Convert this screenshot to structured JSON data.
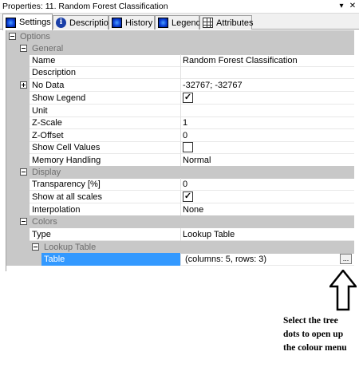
{
  "window": {
    "title": "Properties: 11. Random Forest Classification"
  },
  "tabs": [
    {
      "label": "Settings",
      "icon": "settings-icon"
    },
    {
      "label": "Description",
      "icon": "info-icon"
    },
    {
      "label": "History",
      "icon": "history-icon"
    },
    {
      "label": "Legend",
      "icon": "legend-icon"
    },
    {
      "label": "Attributes",
      "icon": "table-icon"
    }
  ],
  "grid": {
    "options": "Options",
    "general": "General",
    "name_label": "Name",
    "name_value": "Random Forest Classification",
    "description_label": "Description",
    "description_value": "",
    "nodata_label": "No Data",
    "nodata_value": "-32767; -32767",
    "show_legend_label": "Show Legend",
    "show_legend_value": true,
    "unit_label": "Unit",
    "unit_value": "",
    "zscale_label": "Z-Scale",
    "zscale_value": "1",
    "zoffset_label": "Z-Offset",
    "zoffset_value": "0",
    "show_cell_values_label": "Show Cell Values",
    "show_cell_values_value": false,
    "memory_label": "Memory Handling",
    "memory_value": "Normal",
    "display": "Display",
    "transparency_label": "Transparency [%]",
    "transparency_value": "0",
    "show_all_scales_label": "Show at all scales",
    "show_all_scales_value": true,
    "interpolation_label": "Interpolation",
    "interpolation_value": "None",
    "colors": "Colors",
    "type_label": "Type",
    "type_value": "Lookup Table",
    "lookup_table": "Lookup Table",
    "table_label": "Table",
    "table_value": "(columns: 5, rows: 3)",
    "ellipsis": "..."
  },
  "annotation": {
    "line1": "Select the tree",
    "line2": "dots to open up",
    "line3": "the colour menu"
  },
  "colors": {
    "selected": "#3399ff",
    "category": "#c8c8c8",
    "category_text": "#6d6d6d"
  }
}
